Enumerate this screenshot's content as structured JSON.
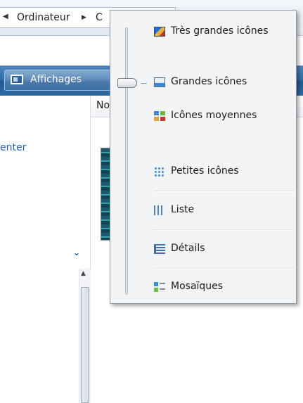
{
  "address_bar": {
    "crumbs": [
      "Ordinateur",
      "C"
    ],
    "separator": "▶",
    "back_glyph": "◀"
  },
  "toolbar": {
    "views_button_label": "Affichages",
    "views_icon": "views-icon"
  },
  "navigation_pane": {
    "link_text": "enter",
    "chevron_glyph": "⌄",
    "scroll_up_glyph": "▲"
  },
  "file_list": {
    "column_header": "No"
  },
  "views_menu": {
    "items": [
      {
        "label": "Très grandes icônes",
        "icon": "extra-large-icons-icon"
      },
      {
        "label": "Grandes icônes",
        "icon": "large-icons-icon"
      },
      {
        "label": "Icônes moyennes",
        "icon": "medium-icons-icon"
      },
      {
        "label": "Petites icônes",
        "icon": "small-icons-icon"
      },
      {
        "label": "Liste",
        "icon": "list-icon"
      },
      {
        "label": "Détails",
        "icon": "details-icon"
      },
      {
        "label": "Mosaïques",
        "icon": "tiles-icon"
      }
    ],
    "selected_item": "Grandes icônes"
  }
}
